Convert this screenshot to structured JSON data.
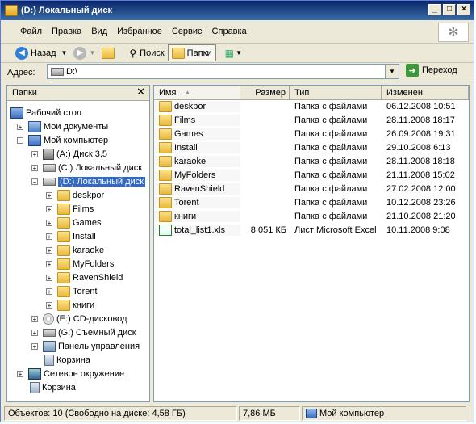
{
  "window": {
    "title": "(D:) Локальный диск"
  },
  "menu": [
    "Файл",
    "Правка",
    "Вид",
    "Избранное",
    "Сервис",
    "Справка"
  ],
  "toolbar": {
    "back": "Назад",
    "search": "Поиск",
    "folders": "Папки"
  },
  "address": {
    "label": "Адрес:",
    "value": "D:\\",
    "go": "Переход"
  },
  "folders_pane": {
    "title": "Папки",
    "tree": [
      {
        "label": "Рабочий стол",
        "icon": "desktop-icon",
        "level": 0,
        "expander": "none"
      },
      {
        "label": "Мои документы",
        "icon": "my-documents-icon",
        "level": 1,
        "expander": "+"
      },
      {
        "label": "Мой компьютер",
        "icon": "my-computer-icon",
        "level": 1,
        "expander": "-"
      },
      {
        "label": "(A:) Диск 3,5",
        "icon": "floppy-drive-icon",
        "level": 2,
        "expander": "+"
      },
      {
        "label": "(C:) Локальный диск",
        "icon": "hard-drive-icon",
        "level": 2,
        "expander": "+"
      },
      {
        "label": "(D:) Локальный диск",
        "icon": "hard-drive-icon",
        "level": 2,
        "expander": "-",
        "selected": true
      },
      {
        "label": "deskpor",
        "icon": "folder-icon",
        "level": 3,
        "expander": "+"
      },
      {
        "label": "Films",
        "icon": "folder-icon",
        "level": 3,
        "expander": "+"
      },
      {
        "label": "Games",
        "icon": "folder-icon",
        "level": 3,
        "expander": "+"
      },
      {
        "label": "Install",
        "icon": "folder-icon",
        "level": 3,
        "expander": "+"
      },
      {
        "label": "karaoke",
        "icon": "folder-icon",
        "level": 3,
        "expander": "+"
      },
      {
        "label": "MyFolders",
        "icon": "folder-icon",
        "level": 3,
        "expander": "+"
      },
      {
        "label": "RavenShield",
        "icon": "folder-icon",
        "level": 3,
        "expander": "+"
      },
      {
        "label": "Torent",
        "icon": "folder-icon",
        "level": 3,
        "expander": "+"
      },
      {
        "label": "книги",
        "icon": "folder-icon",
        "level": 3,
        "expander": "+"
      },
      {
        "label": "(E:) CD-дисковод",
        "icon": "cd-drive-icon",
        "level": 2,
        "expander": "+"
      },
      {
        "label": "(G:) Съемный диск",
        "icon": "removable-drive-icon",
        "level": 2,
        "expander": "+"
      },
      {
        "label": "Панель управления",
        "icon": "control-panel-icon",
        "level": 2,
        "expander": "+"
      },
      {
        "label": "Корзина",
        "icon": "recycle-bin-icon",
        "level": 2,
        "expander": "none"
      },
      {
        "label": "Сетевое окружение",
        "icon": "network-icon",
        "level": 1,
        "expander": "+"
      },
      {
        "label": "Корзина",
        "icon": "recycle-bin-icon",
        "level": 1,
        "expander": "none"
      }
    ]
  },
  "file_list": {
    "columns": [
      "Имя",
      "Размер",
      "Тип",
      "Изменен"
    ],
    "rows": [
      {
        "name": "deskpor",
        "size": "",
        "type": "Папка с файлами",
        "modified": "06.12.2008 10:51",
        "icon": "folder-icon"
      },
      {
        "name": "Films",
        "size": "",
        "type": "Папка с файлами",
        "modified": "28.11.2008 18:17",
        "icon": "folder-icon"
      },
      {
        "name": "Games",
        "size": "",
        "type": "Папка с файлами",
        "modified": "26.09.2008 19:31",
        "icon": "folder-icon"
      },
      {
        "name": "Install",
        "size": "",
        "type": "Папка с файлами",
        "modified": "29.10.2008 6:13",
        "icon": "folder-icon"
      },
      {
        "name": "karaoke",
        "size": "",
        "type": "Папка с файлами",
        "modified": "28.11.2008 18:18",
        "icon": "folder-icon"
      },
      {
        "name": "MyFolders",
        "size": "",
        "type": "Папка с файлами",
        "modified": "21.11.2008 15:02",
        "icon": "folder-icon"
      },
      {
        "name": "RavenShield",
        "size": "",
        "type": "Папка с файлами",
        "modified": "27.02.2008 12:00",
        "icon": "folder-icon"
      },
      {
        "name": "Torent",
        "size": "",
        "type": "Папка с файлами",
        "modified": "10.12.2008 23:26",
        "icon": "folder-icon"
      },
      {
        "name": "книги",
        "size": "",
        "type": "Папка с файлами",
        "modified": "21.10.2008 21:20",
        "icon": "folder-icon"
      },
      {
        "name": "total_list1.xls",
        "size": "8 051 КБ",
        "type": "Лист Microsoft Excel",
        "modified": "10.11.2008 9:08",
        "icon": "excel-file-icon"
      }
    ]
  },
  "status": {
    "objects": "Объектов: 10 (Свободно на диске: 4,58 ГБ)",
    "size": "7,86 МБ",
    "location": "Мой компьютер"
  }
}
